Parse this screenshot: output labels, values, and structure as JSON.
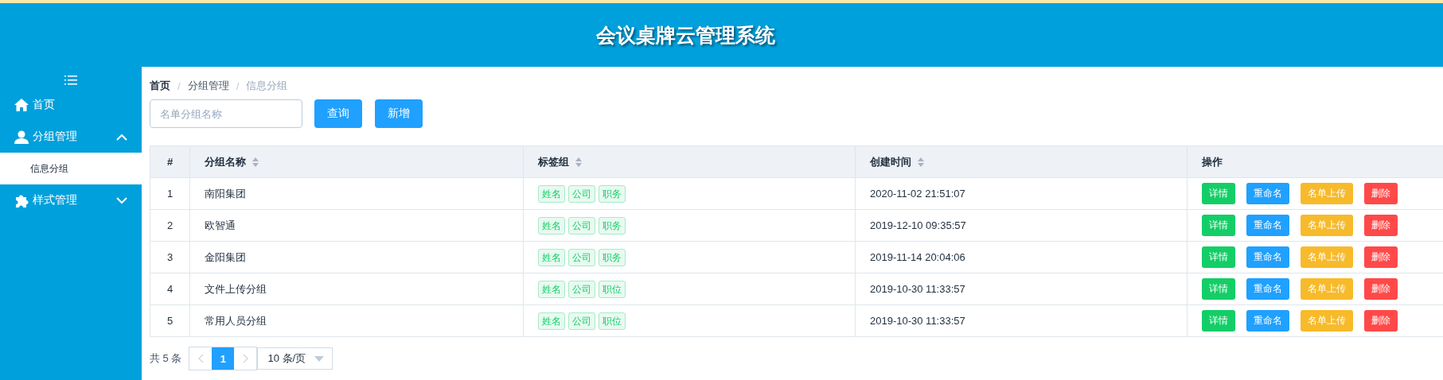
{
  "header": {
    "title": "会议桌牌云管理系统"
  },
  "sidebar": {
    "items": [
      {
        "label": "首页",
        "kind": "home"
      },
      {
        "label": "分组管理",
        "kind": "user",
        "expanded": true,
        "children": [
          {
            "label": "信息分组",
            "selected": true
          }
        ]
      },
      {
        "label": "样式管理",
        "kind": "puzzle",
        "expanded": false
      }
    ]
  },
  "breadcrumb": {
    "separator": "/",
    "items": [
      "首页",
      "分组管理",
      "信息分组"
    ]
  },
  "search": {
    "placeholder": "名单分组名称"
  },
  "toolbar_buttons": [
    "查询",
    "新增"
  ],
  "table": {
    "columns": [
      {
        "label": "#",
        "sortable": false
      },
      {
        "label": "分组名称",
        "sortable": true
      },
      {
        "label": "标签组",
        "sortable": true
      },
      {
        "label": "创建时间",
        "sortable": true
      },
      {
        "label": "操作",
        "sortable": false
      }
    ],
    "rows": [
      {
        "index": "1",
        "name": "南阳集团",
        "tags": [
          "姓名",
          "公司",
          "职务"
        ],
        "created": "2020-11-02 21:51:07",
        "actions": [
          {
            "label": "详情",
            "kind": "success"
          },
          {
            "label": "重命名",
            "kind": "primary"
          },
          {
            "label": "名单上传",
            "kind": "warning"
          },
          {
            "label": "删除",
            "kind": "danger"
          }
        ]
      },
      {
        "index": "2",
        "name": "欧智通",
        "tags": [
          "姓名",
          "公司",
          "职务"
        ],
        "created": "2019-12-10 09:35:57",
        "actions": [
          {
            "label": "详情",
            "kind": "success"
          },
          {
            "label": "重命名",
            "kind": "primary"
          },
          {
            "label": "名单上传",
            "kind": "warning"
          },
          {
            "label": "删除",
            "kind": "danger"
          }
        ]
      },
      {
        "index": "3",
        "name": "金阳集团",
        "tags": [
          "姓名",
          "公司",
          "职务"
        ],
        "created": "2019-11-14 20:04:06",
        "actions": [
          {
            "label": "详情",
            "kind": "success"
          },
          {
            "label": "重命名",
            "kind": "primary"
          },
          {
            "label": "名单上传",
            "kind": "warning"
          },
          {
            "label": "删除",
            "kind": "danger"
          }
        ]
      },
      {
        "index": "4",
        "name": "文件上传分组",
        "tags": [
          "姓名",
          "公司",
          "职位"
        ],
        "created": "2019-10-30 11:33:57",
        "actions": [
          {
            "label": "详情",
            "kind": "success"
          },
          {
            "label": "重命名",
            "kind": "primary"
          },
          {
            "label": "名单上传",
            "kind": "warning"
          },
          {
            "label": "删除",
            "kind": "danger"
          }
        ]
      },
      {
        "index": "5",
        "name": "常用人员分组",
        "tags": [
          "姓名",
          "公司",
          "职位"
        ],
        "created": "2019-10-30 11:33:57",
        "actions": [
          {
            "label": "详情",
            "kind": "success"
          },
          {
            "label": "重命名",
            "kind": "primary"
          },
          {
            "label": "名单上传",
            "kind": "warning"
          },
          {
            "label": "删除",
            "kind": "danger"
          }
        ]
      }
    ]
  },
  "pagination": {
    "total": "共 5 条",
    "pages": [
      {
        "label": "1",
        "selected": true
      }
    ],
    "page_size": "10 条/页"
  }
}
